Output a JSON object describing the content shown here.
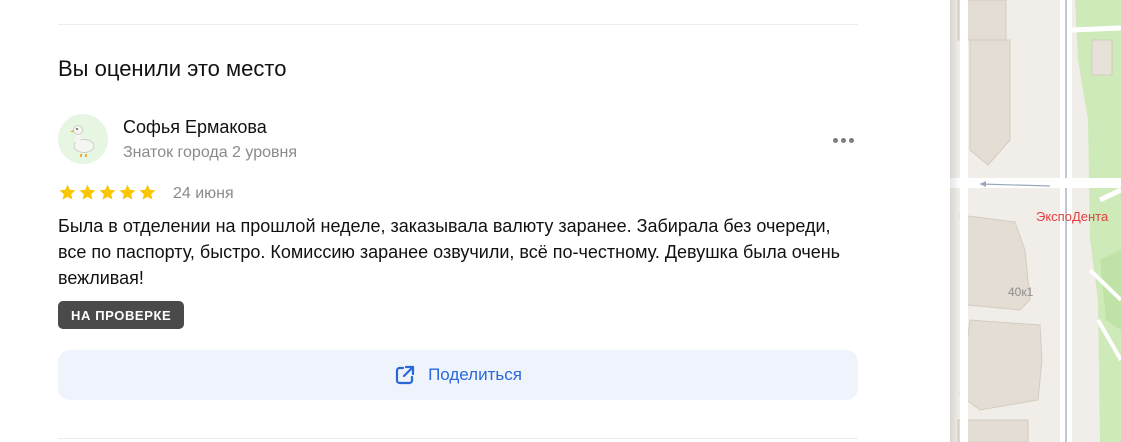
{
  "section": {
    "title": "Вы оценили это место"
  },
  "review": {
    "author_name": "Софья Ермакова",
    "author_level": "Знаток города 2 уровня",
    "rating": 5,
    "rating_max": 5,
    "date": "24 июня",
    "text": "Была в отделении на прошлой неделе, заказывала валюту заранее. Забирала без очереди, все по паспорту, быстро. Комиссию заранее озвучили, всё по-честному. Девушка была очень вежливая!",
    "status": "НА ПРОВЕРКЕ"
  },
  "actions": {
    "share_label": "Поделиться"
  },
  "map": {
    "poi_label": "ЭкспоДента",
    "building_label": "40к1"
  },
  "colors": {
    "star": "#f7c600",
    "accent": "#2a68d8",
    "badge_bg": "#4a4a4a",
    "share_bg": "#eef3fc",
    "avatar_bg": "#e6f6e3",
    "map_poi": "#e0413f"
  }
}
